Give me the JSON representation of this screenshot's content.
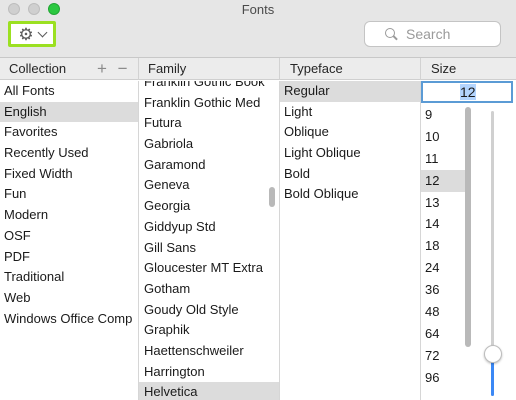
{
  "window": {
    "title": "Fonts"
  },
  "toolbar": {
    "action_icon": "gear-icon",
    "search_placeholder": "Search"
  },
  "headers": {
    "collection": "Collection",
    "family": "Family",
    "typeface": "Typeface",
    "size": "Size",
    "add_remove": "+ −"
  },
  "collections": [
    "All Fonts",
    "English",
    "Favorites",
    "Recently Used",
    "Fixed Width",
    "Fun",
    "Modern",
    "OSF",
    "PDF",
    "Traditional",
    "Web",
    "Windows Office Comp"
  ],
  "collections_selected": "English",
  "families": [
    "Franklin Gothic Book",
    "Franklin Gothic Med",
    "Futura",
    "Gabriola",
    "Garamond",
    "Geneva",
    "Georgia",
    "Giddyup Std",
    "Gill Sans",
    "Gloucester MT Extra",
    "Gotham",
    "Goudy Old Style",
    "Graphik",
    "Haettenschweiler",
    "Harrington",
    "Helvetica"
  ],
  "families_selected": "Helvetica",
  "typefaces": [
    "Regular",
    "Light",
    "Oblique",
    "Light Oblique",
    "Bold",
    "Bold Oblique"
  ],
  "typefaces_selected": "Regular",
  "size": {
    "current": "12",
    "options": [
      "9",
      "10",
      "11",
      "12",
      "13",
      "14",
      "18",
      "24",
      "36",
      "48",
      "64",
      "72",
      "96"
    ],
    "selected": "12"
  },
  "colors": {
    "highlight": "#9be021",
    "focus": "#5b9bd5",
    "slider_fill": "#3b88f5",
    "zoom": "#2bc840"
  }
}
